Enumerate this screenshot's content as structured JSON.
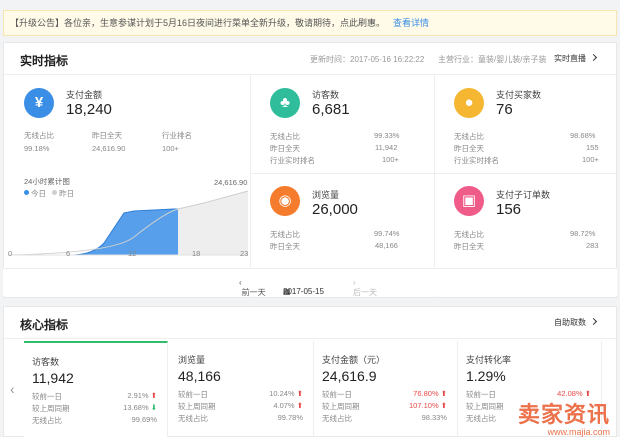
{
  "notice": {
    "text": "【升级公告】各位亲，生意参谋计划于5月16日夜间进行菜单全新升级，敬请期待，点此刷惠。",
    "link": "查看详情"
  },
  "realtime": {
    "title": "实时指标",
    "update_time": "更新时间：2017-05-16 16:22:22",
    "industry": "主营行业：童装/婴儿装/亲子装",
    "live_button": "实时直播",
    "metrics": {
      "pay_amount": {
        "label": "支付金额",
        "value": "18,240",
        "icon": "yen-icon",
        "stats_headers": [
          "无线占比",
          "昨日全天",
          "行业排名"
        ],
        "stats_values": [
          "99.18%",
          "24,616.90",
          "100+"
        ]
      },
      "visitors": {
        "label": "访客数",
        "value": "6,681",
        "icon": "footprint-icon",
        "rows": [
          {
            "k": "无线占比",
            "v": "99.33%"
          },
          {
            "k": "昨日全天",
            "v": "11,942"
          },
          {
            "k": "行业实时排名",
            "v": "100+"
          }
        ]
      },
      "buyers": {
        "label": "支付买家数",
        "value": "76",
        "icon": "user-icon",
        "rows": [
          {
            "k": "无线占比",
            "v": "98.68%"
          },
          {
            "k": "昨日全天",
            "v": "155"
          },
          {
            "k": "行业实时排名",
            "v": "100+"
          }
        ]
      },
      "pageviews": {
        "label": "浏览量",
        "value": "26,000",
        "icon": "eye-icon",
        "rows": [
          {
            "k": "无线占比",
            "v": "99.74%"
          },
          {
            "k": "昨日全天",
            "v": "48,166"
          }
        ]
      },
      "orders": {
        "label": "支付子订单数",
        "value": "156",
        "icon": "order-icon",
        "rows": [
          {
            "k": "无线占比",
            "v": "98.72%"
          },
          {
            "k": "昨日全天",
            "v": "283"
          }
        ]
      }
    },
    "chart": {
      "title": "24小时累计图",
      "legend_today": "今日",
      "legend_yesterday": "昨日",
      "peak_label": "24,616.90",
      "x_ticks": [
        "0",
        "6",
        "12",
        "18",
        "23"
      ]
    },
    "datebar": {
      "prev": "前一天",
      "date": "2017-05-15",
      "next": "后一天"
    }
  },
  "core": {
    "title": "核心指标",
    "custom_button": "自助取数",
    "cards": [
      {
        "label": "访客数",
        "value": "11,942",
        "rows": [
          {
            "k": "较前一日",
            "v": "2.91%",
            "dir": "up"
          },
          {
            "k": "较上周同期",
            "v": "13.68%",
            "dir": "down"
          },
          {
            "k": "无线占比",
            "v": "99.69%",
            "dir": ""
          }
        ]
      },
      {
        "label": "浏览量",
        "value": "48,166",
        "rows": [
          {
            "k": "较前一日",
            "v": "10.24%",
            "dir": "up"
          },
          {
            "k": "较上周同期",
            "v": "4.07%",
            "dir": "up"
          },
          {
            "k": "无线占比",
            "v": "99.78%",
            "dir": ""
          }
        ]
      },
      {
        "label": "支付金额（元）",
        "value": "24,616.9",
        "rows": [
          {
            "k": "较前一日",
            "v": "76.80%",
            "dir": "up",
            "red": true
          },
          {
            "k": "较上周同期",
            "v": "107.10%",
            "dir": "up",
            "red": true
          },
          {
            "k": "无线占比",
            "v": "98.33%",
            "dir": ""
          }
        ]
      },
      {
        "label": "支付转化率",
        "value": "1.29%",
        "rows": [
          {
            "k": "较前一日",
            "v": "42.08%",
            "dir": "up",
            "red": true
          },
          {
            "k": "较上周同期",
            "v": "",
            "dir": ""
          },
          {
            "k": "无线占比",
            "v": "",
            "dir": ""
          }
        ]
      }
    ]
  },
  "watermark": {
    "main": "卖家资讯",
    "sub": "www.majia.com"
  },
  "colors": {
    "yen": "#3a8ee6",
    "footprint": "#2fbd9b",
    "user": "#f5b731",
    "eye": "#f57c2c",
    "order": "#f05c8a",
    "chart_fill": "#3a8ee6",
    "chart_yesterday": "#cfcfcf"
  }
}
